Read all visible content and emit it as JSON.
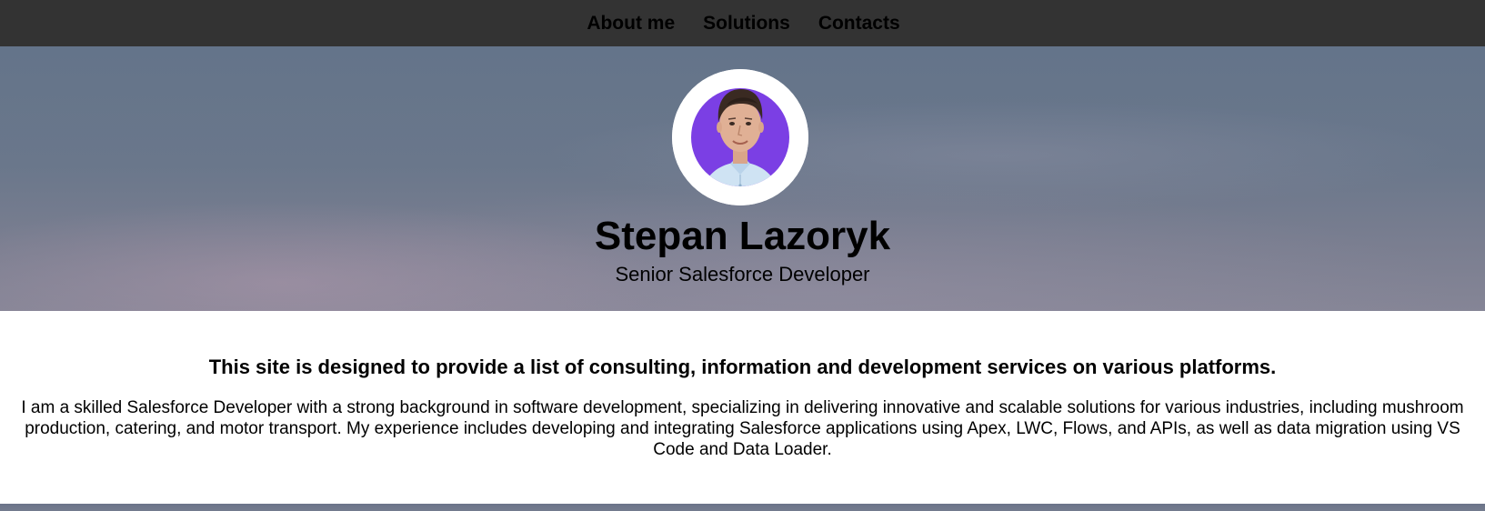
{
  "nav": {
    "items": [
      {
        "label": "About me"
      },
      {
        "label": "Solutions"
      },
      {
        "label": "Contacts"
      }
    ]
  },
  "hero": {
    "name": "Stepan Lazoryk",
    "title": "Senior Salesforce Developer",
    "avatar_icon": "profile-photo"
  },
  "about": {
    "heading": "This site is designed to provide a list of consulting, information and development services on various platforms.",
    "body": "I am a skilled Salesforce Developer with a strong background in software development, specializing in delivering innovative and scalable solutions for various industries, including mushroom production, catering, and motor transport. My experience includes developing and integrating Salesforce applications using Apex, LWC, Flows, and APIs, as well as data migration using VS Code and Data Loader."
  },
  "colors": {
    "nav_background": "#333333",
    "avatar_accent": "#7b3fe4",
    "shirt": "#cfe3f3"
  }
}
